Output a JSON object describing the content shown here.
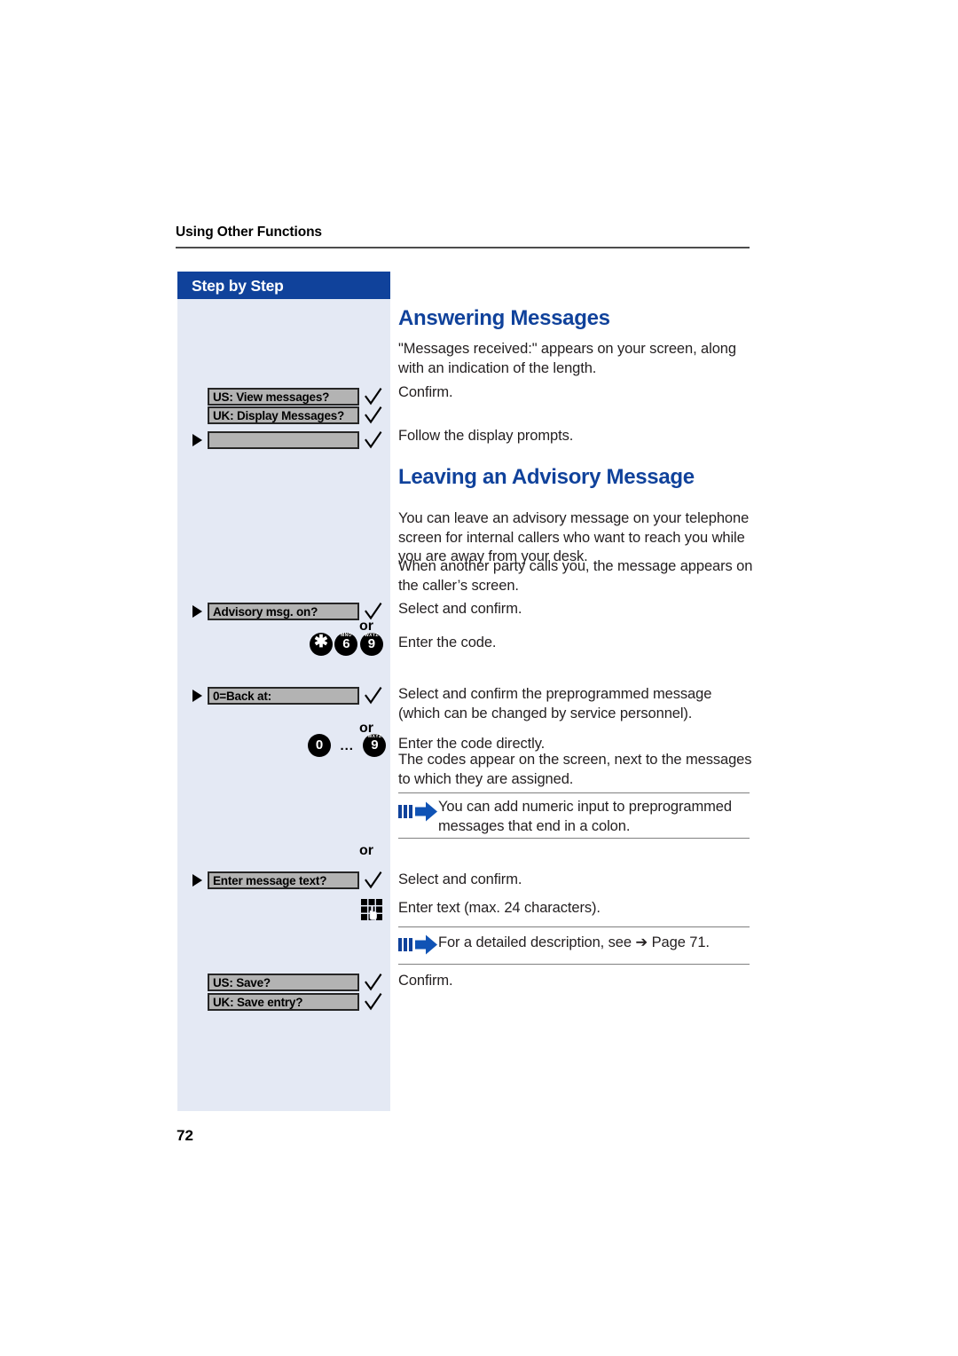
{
  "page": {
    "running_head": "Using Other Functions",
    "folio": "72",
    "accent_blue": "#10429b",
    "sidebar_bg": "#e4e9f4",
    "display_box_bg": "#b3b3b3"
  },
  "sidebar": {
    "header_label": "Step by Step",
    "rows": [
      {
        "id": "us-view-messages",
        "bullet": false,
        "text": "US: View messages?",
        "check": true
      },
      {
        "id": "uk-display-messages",
        "bullet": false,
        "text": "UK: Display Messages?",
        "check": true
      },
      {
        "id": "blank-prompt",
        "bullet": true,
        "text": "",
        "check": true
      },
      {
        "id": "advisory-msg-on",
        "bullet": true,
        "text": "Advisory msg. on?",
        "check": true
      },
      {
        "id": "back-at",
        "bullet": true,
        "text": "0=Back at:",
        "check": true
      },
      {
        "id": "enter-message-text",
        "bullet": true,
        "text": "Enter message text?",
        "check": true
      },
      {
        "id": "us-save",
        "bullet": false,
        "text": "US: Save?",
        "check": true
      },
      {
        "id": "uk-save-entry",
        "bullet": false,
        "text": "UK: Save entry?",
        "check": true
      }
    ],
    "or_labels": [
      "or",
      "or",
      "or"
    ],
    "key_sequence_code": [
      {
        "digit": "✱",
        "letters": ""
      },
      {
        "digit": "6",
        "letters": "MNO"
      },
      {
        "digit": "9",
        "letters": "WXYZ"
      }
    ],
    "key_range_direct": {
      "from": {
        "digit": "0",
        "letters": ""
      },
      "separator": "...",
      "to": {
        "digit": "9",
        "letters": "WXYZ"
      }
    },
    "keypad_icon_name": "keypad-entry-icon"
  },
  "main": {
    "heading_1": "Answering Messages",
    "intro_1": "\"Messages received:\" appears on your screen, along with an indication of the length.",
    "step_confirm_1": "Confirm.",
    "step_follow_prompts": "Follow the display prompts.",
    "heading_2": "Leaving an Advisory Message",
    "intro_2": "You can leave an advisory message on your telephone screen for internal callers who want to reach you while you are away from your desk.",
    "intro_2b": "When another party calls you, the message appears on the caller’s screen.",
    "step_select_confirm_1": "Select and confirm.",
    "step_enter_code": "Enter the code.",
    "step_select_confirm_preprogrammed": "Select and confirm the preprogrammed message (which can be changed by service personnel).",
    "step_enter_code_directly": "Enter the code directly.",
    "step_codes_appear": "The codes appear on the screen, next to the messages to which they are assigned.",
    "note_1": "You can add numeric input to preprogrammed messages that end in a colon.",
    "step_select_confirm_2": "Select and confirm.",
    "step_enter_text": "Enter text (max. 24 characters).",
    "note_2": "For a detailed description, see ➔ Page 71.",
    "step_confirm_2": "Confirm."
  }
}
